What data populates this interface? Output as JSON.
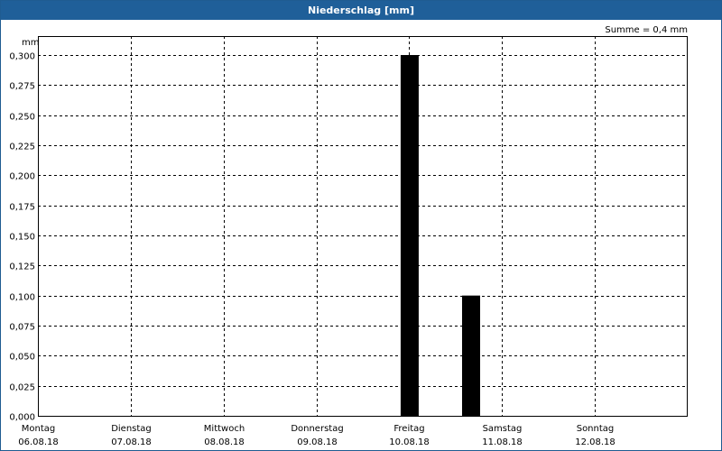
{
  "window": {
    "title": "Niederschlag [mm]"
  },
  "chart_data": {
    "type": "bar",
    "title": "Niederschlag [mm]",
    "ylabel": "mm",
    "summary": "Summe = 0,4 mm",
    "ylim": [
      0,
      0.3
    ],
    "grid": true,
    "yticks": [
      "0,000",
      "0,025",
      "0,050",
      "0,075",
      "0,100",
      "0,125",
      "0,150",
      "0,175",
      "0,200",
      "0,225",
      "0,250",
      "0,275",
      "0,300"
    ],
    "days": [
      {
        "day": "Montag",
        "date": "06.08.18"
      },
      {
        "day": "Dienstag",
        "date": "07.08.18"
      },
      {
        "day": "Mittwoch",
        "date": "08.08.18"
      },
      {
        "day": "Donnerstag",
        "date": "09.08.18"
      },
      {
        "day": "Freitag",
        "date": "10.08.18"
      },
      {
        "day": "Samstag",
        "date": "11.08.18"
      },
      {
        "day": "Sonntag",
        "date": "12.08.18"
      }
    ],
    "bars": [
      {
        "date": "10.08.18",
        "hour": 0,
        "value": 0.3
      },
      {
        "date": "10.08.18",
        "hour": 16,
        "value": 0.1
      }
    ],
    "colors": {
      "bar": "#000000",
      "title_bg": "#1f5f99"
    }
  }
}
